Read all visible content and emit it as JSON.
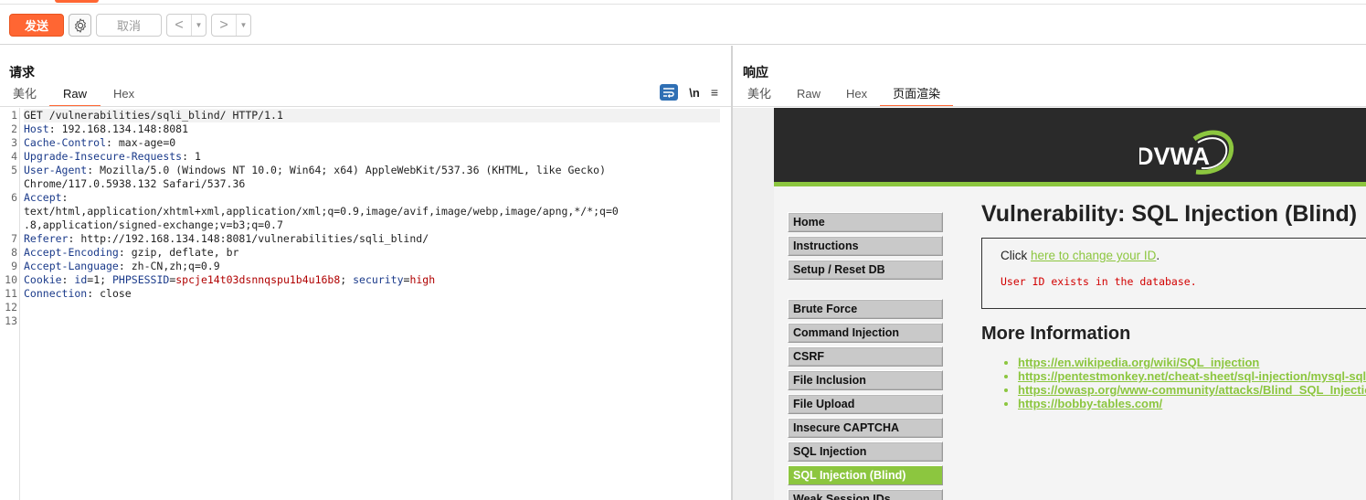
{
  "toolbar": {
    "send_label": "发送",
    "cancel_label": "取消",
    "back_arrow": "<",
    "forward_arrow": ">",
    "dropdown_arrow": "▼"
  },
  "request": {
    "title": "请求",
    "tabs": [
      "美化",
      "Raw",
      "Hex"
    ],
    "active_tab": "Raw",
    "newline_tool": "\\n",
    "menu_tool": "≡",
    "lines": [
      {
        "num": "1",
        "key": "",
        "sep": "",
        "value": "GET /vulnerabilities/sqli_blind/ HTTP/1.1"
      },
      {
        "num": "2",
        "key": "Host",
        "sep": ": ",
        "value": "192.168.134.148:8081"
      },
      {
        "num": "3",
        "key": "Cache-Control",
        "sep": ": ",
        "value": "max-age=0"
      },
      {
        "num": "4",
        "key": "Upgrade-Insecure-Requests",
        "sep": ": ",
        "value": "1"
      },
      {
        "num": "5",
        "key": "User-Agent",
        "sep": ": ",
        "value": "Mozilla/5.0 (Windows NT 10.0; Win64; x64) AppleWebKit/537.36 (KHTML, like Gecko)"
      },
      {
        "num": "",
        "key": "",
        "sep": "",
        "value": "Chrome/117.0.5938.132 Safari/537.36"
      },
      {
        "num": "6",
        "key": "Accept",
        "sep": ":",
        "value": ""
      },
      {
        "num": "",
        "key": "",
        "sep": "",
        "value": "text/html,application/xhtml+xml,application/xml;q=0.9,image/avif,image/webp,image/apng,*/*;q=0"
      },
      {
        "num": "",
        "key": "",
        "sep": "",
        "value": ".8,application/signed-exchange;v=b3;q=0.7"
      },
      {
        "num": "7",
        "key": "Referer",
        "sep": ": ",
        "value": "http://192.168.134.148:8081/vulnerabilities/sqli_blind/"
      },
      {
        "num": "8",
        "key": "Accept-Encoding",
        "sep": ": ",
        "value": "gzip, deflate, br"
      },
      {
        "num": "9",
        "key": "Accept-Language",
        "sep": ": ",
        "value": "zh-CN,zh;q=0.9"
      },
      {
        "num": "10",
        "key": "Cookie",
        "sep": ": ",
        "value": ""
      },
      {
        "num": "11",
        "key": "Connection",
        "sep": ": ",
        "value": "close"
      },
      {
        "num": "12",
        "key": "",
        "sep": "",
        "value": ""
      },
      {
        "num": "13",
        "key": "",
        "sep": "",
        "value": ""
      }
    ],
    "cookie": {
      "id_key": "id",
      "id_val": "1",
      "sess_key": "PHPSESSID",
      "sess_val": "spcje14t03dsnnqspu1b4u16b8",
      "sec_key": "security",
      "sec_val": "high"
    }
  },
  "response": {
    "title": "响应",
    "tabs": [
      "美化",
      "Raw",
      "Hex",
      "页面渲染"
    ],
    "active_tab": "页面渲染",
    "page": {
      "logo_text": "DVWA",
      "menu": [
        "Home",
        "Instructions",
        "Setup / Reset DB",
        "Brute Force",
        "Command Injection",
        "CSRF",
        "File Inclusion",
        "File Upload",
        "Insecure CAPTCHA",
        "SQL Injection",
        "SQL Injection (Blind)",
        "Weak Session IDs"
      ],
      "active_menu": "SQL Injection (Blind)",
      "heading": "Vulnerability: SQL Injection (Blind)",
      "click_prefix": "Click ",
      "click_link": "here to change your ID",
      "click_suffix": ".",
      "result_msg": "User ID exists in the database.",
      "more_info_title": "More Information",
      "links": [
        "https://en.wikipedia.org/wiki/SQL_injection",
        "https://pentestmonkey.net/cheat-sheet/sql-injection/mysql-sql-injection-cheat-sheet",
        "https://owasp.org/www-community/attacks/Blind_SQL_Injection",
        "https://bobby-tables.com/"
      ]
    }
  },
  "colors": {
    "accent": "#ff6633",
    "dvwa_green": "#8cc63f",
    "cookie_value": "#b00000"
  }
}
